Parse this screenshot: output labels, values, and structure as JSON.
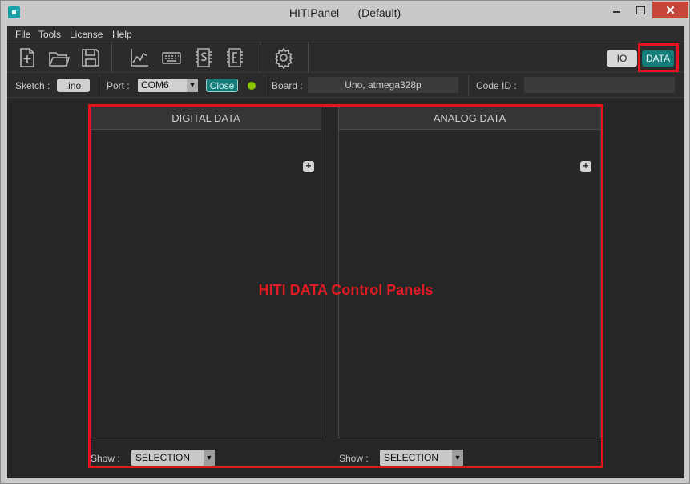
{
  "window": {
    "title": "HITIPanel      (Default)",
    "close_glyph": "✕"
  },
  "menu": [
    "File",
    "Tools",
    "License",
    "Help"
  ],
  "toolbar": {
    "icons": [
      "new-file-icon",
      "open-folder-icon",
      "save-icon",
      "chart-icon",
      "keyboard-icon",
      "sketch-s-icon",
      "eeprom-e-icon",
      "gear-icon"
    ],
    "io_label": "IO",
    "data_label": "DATA"
  },
  "status": {
    "sketch_label": "Sketch :",
    "sketch_value": ".ino",
    "port_label": "Port :",
    "port_value": "COM6",
    "close_label": "Close",
    "board_label": "Board :",
    "board_value": "Uno, atmega328p",
    "code_id_label": "Code ID :",
    "code_id_value": ""
  },
  "panels": {
    "digital_title": "DIGITAL  DATA",
    "analog_title": "ANALOG  DATA",
    "plus": "+",
    "show_label": "Show :",
    "digital_show_value": "SELECTION",
    "analog_show_value": "SELECTION"
  },
  "annotation": {
    "caption": "HITI DATA Control Panels"
  },
  "colors": {
    "accent": "#147c78",
    "highlight": "#e4141e",
    "led": "#8bc400",
    "close": "#c7463c"
  }
}
